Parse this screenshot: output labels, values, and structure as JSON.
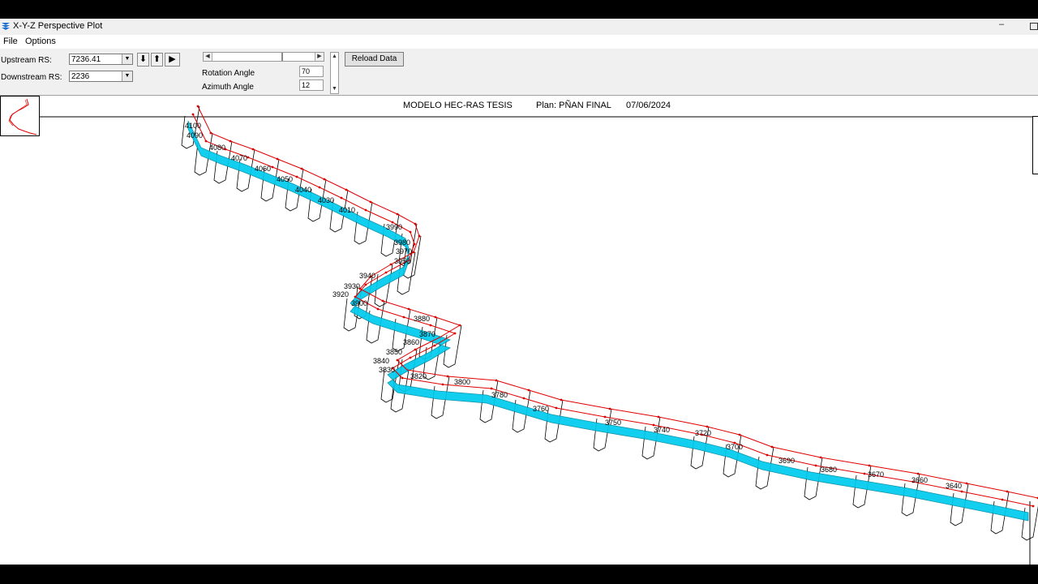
{
  "window": {
    "title": "X-Y-Z Perspective Plot",
    "minimize_glyph": "–"
  },
  "menu": {
    "file": "File",
    "options": "Options"
  },
  "toolbar": {
    "upstream_label": "Upstream RS:",
    "upstream_value": "7236.41",
    "downstream_label": "Downstream RS:",
    "downstream_value": "2236",
    "rotation_label": "Rotation Angle",
    "rotation_value": "70",
    "azimuth_label": "Azimuth Angle",
    "azimuth_value": "12",
    "reload_label": "Reload Data",
    "btn_down_glyph": "⬇",
    "btn_up_glyph": "⬆",
    "btn_play_glyph": "▶"
  },
  "plot_header": {
    "project": "MODELO HEC-RAS TESIS",
    "plan": "Plan: PÑAN FINAL",
    "date": "07/06/2024"
  },
  "colors": {
    "water": "#00ccee",
    "bank_lines": "#e00000",
    "section_lines": "#000000"
  },
  "station_labels": [
    "4100",
    "4090",
    "4080",
    "4070",
    "4060",
    "4050",
    "4040",
    "4030",
    "4010",
    "3990",
    "3980",
    "3970",
    "3950",
    "3940",
    "3930",
    "3920",
    "3900",
    "3880",
    "3870",
    "3860",
    "3850",
    "3840",
    "3830",
    "3820",
    "3800",
    "3780",
    "3760",
    "3750",
    "3740",
    "3720",
    "3700",
    "3690",
    "3680",
    "3670",
    "3660",
    "3640"
  ]
}
